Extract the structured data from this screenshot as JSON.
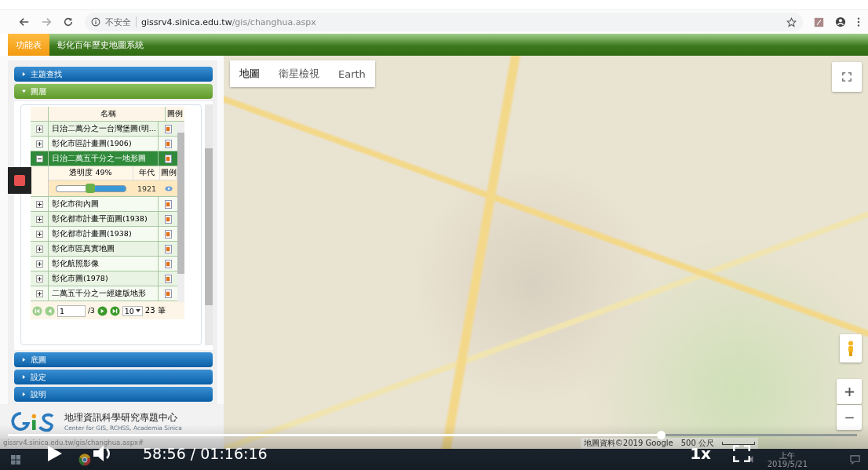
{
  "browser": {
    "security": "不安全",
    "url_host": "gissrv4.sinica.edu.tw",
    "url_path": "/gis/changhua.aspx"
  },
  "app_header": {
    "menu_tab": "功能表",
    "title": "彰化百年歷史地圖系統"
  },
  "sidebar": {
    "sections": [
      {
        "label": "主題查找",
        "expanded": false
      },
      {
        "label": "圖層",
        "expanded": true,
        "layers": {
          "columns": [
            "名稱",
            "圖例"
          ],
          "rows": [
            {
              "name": "日治二萬分之一台灣堡圖(明...",
              "selected": false,
              "expanded": false
            },
            {
              "name": "彰化市區計畫圖(1906)",
              "selected": false,
              "expanded": false
            },
            {
              "name": "日治二萬五千分之一地形圖",
              "selected": true,
              "expanded": true,
              "detail": {
                "opacity_label": "透明度 49%",
                "year_header": "年代",
                "legend_header": "圖例",
                "year": "1921",
                "level": 0.49
              }
            },
            {
              "name": "彰化市街內圖",
              "selected": false,
              "expanded": false
            },
            {
              "name": "彰化都市計畫平面圖(1938)",
              "selected": false,
              "expanded": false
            },
            {
              "name": "彰化都市計畫圖(1938)",
              "selected": false,
              "expanded": false
            },
            {
              "name": "彰化市區真實地圖",
              "selected": false,
              "expanded": false
            },
            {
              "name": "彰化航照影像",
              "selected": false,
              "expanded": false
            },
            {
              "name": "彰化市圖(1978)",
              "selected": false,
              "expanded": false
            },
            {
              "name": "二萬五千分之一經建版地形",
              "selected": false,
              "expanded": false
            }
          ],
          "pager": {
            "page": "1",
            "pages": "/3",
            "page_size": "10",
            "total": "23 筆"
          }
        }
      },
      {
        "label": "底圖",
        "expanded": false
      },
      {
        "label": "設定",
        "expanded": false
      },
      {
        "label": "說明",
        "expanded": false
      }
    ]
  },
  "footer": {
    "logo_title": "地理資訊科學研究專題中心",
    "logo_subtitle": "Center for GIS, RCHSS, Academia Sinica"
  },
  "status_url": "gissrv4.sinica.edu.tw/gis/changhua.aspx#",
  "map": {
    "map_types": [
      {
        "label": "地圖",
        "selected": true
      },
      {
        "label": "衛星檢視",
        "selected": false
      },
      {
        "label": "Earth",
        "selected": false
      }
    ],
    "attribution": "地圖資料©2019 Google",
    "scale": "500 公尺"
  },
  "video": {
    "time": "58:56 / 01:16:16",
    "speed": "1x",
    "level": 0.77
  },
  "taskbar": {
    "clock_top": "上午",
    "clock_date": "2019/5/21"
  }
}
